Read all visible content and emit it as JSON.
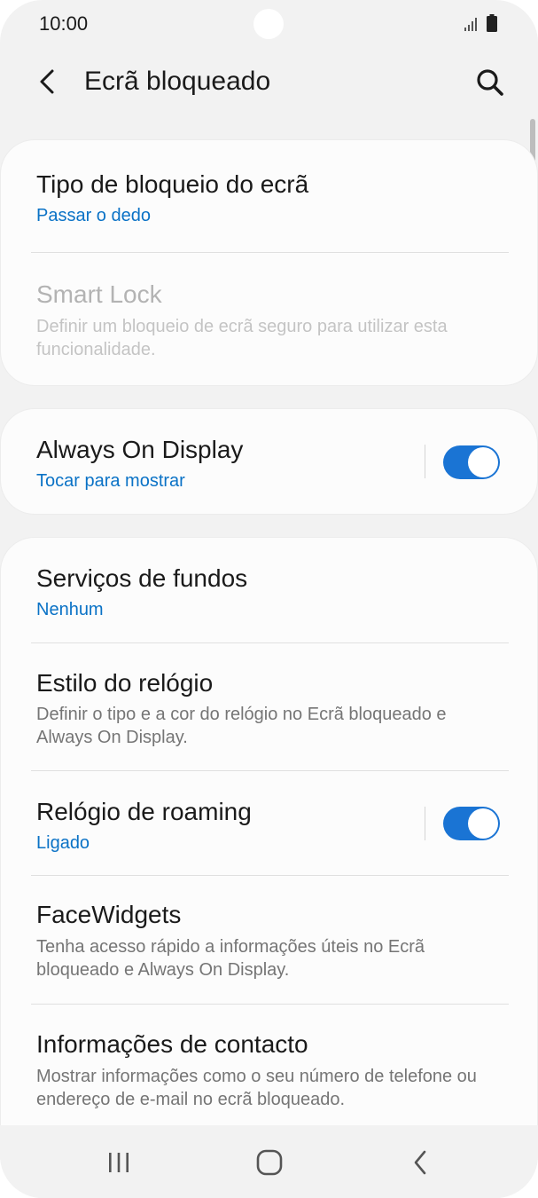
{
  "status_bar": {
    "time": "10:00",
    "icons": [
      "signal-icon",
      "battery-icon"
    ]
  },
  "app_bar": {
    "title": "Ecrã bloqueado",
    "back_icon": "back-arrow-icon",
    "search_icon": "search-icon"
  },
  "cards": [
    {
      "items": [
        {
          "title": "Tipo de bloqueio do ecrã",
          "subtitle": "Passar o dedo"
        },
        {
          "title": "Smart Lock",
          "description": "Definir um bloqueio de ecrã seguro para utilizar esta funcionalidade.",
          "disabled": true
        }
      ]
    },
    {
      "items": [
        {
          "title": "Always On Display",
          "subtitle": "Tocar para mostrar",
          "toggle": true
        }
      ]
    },
    {
      "items": [
        {
          "title": "Serviços de fundos",
          "subtitle": "Nenhum"
        },
        {
          "title": "Estilo do relógio",
          "description": "Definir o tipo e a cor do relógio no Ecrã bloqueado e Always On Display."
        },
        {
          "title": "Relógio de roaming",
          "subtitle": "Ligado",
          "toggle": true
        },
        {
          "title": "FaceWidgets",
          "description": "Tenha acesso rápido a informações úteis no Ecrã bloqueado e Always On Display."
        },
        {
          "title": "Informações de contacto",
          "description": "Mostrar informações como o seu número de telefone ou endereço de e-mail no ecrã bloqueado."
        }
      ]
    }
  ],
  "nav_bar": {
    "buttons": [
      "recent-apps-icon",
      "home-icon",
      "back-icon"
    ]
  },
  "colors": {
    "accent": "#0a72c6",
    "toggle_on": "#1a74d4",
    "background": "#f2f2f2",
    "card": "#fcfcfc"
  }
}
